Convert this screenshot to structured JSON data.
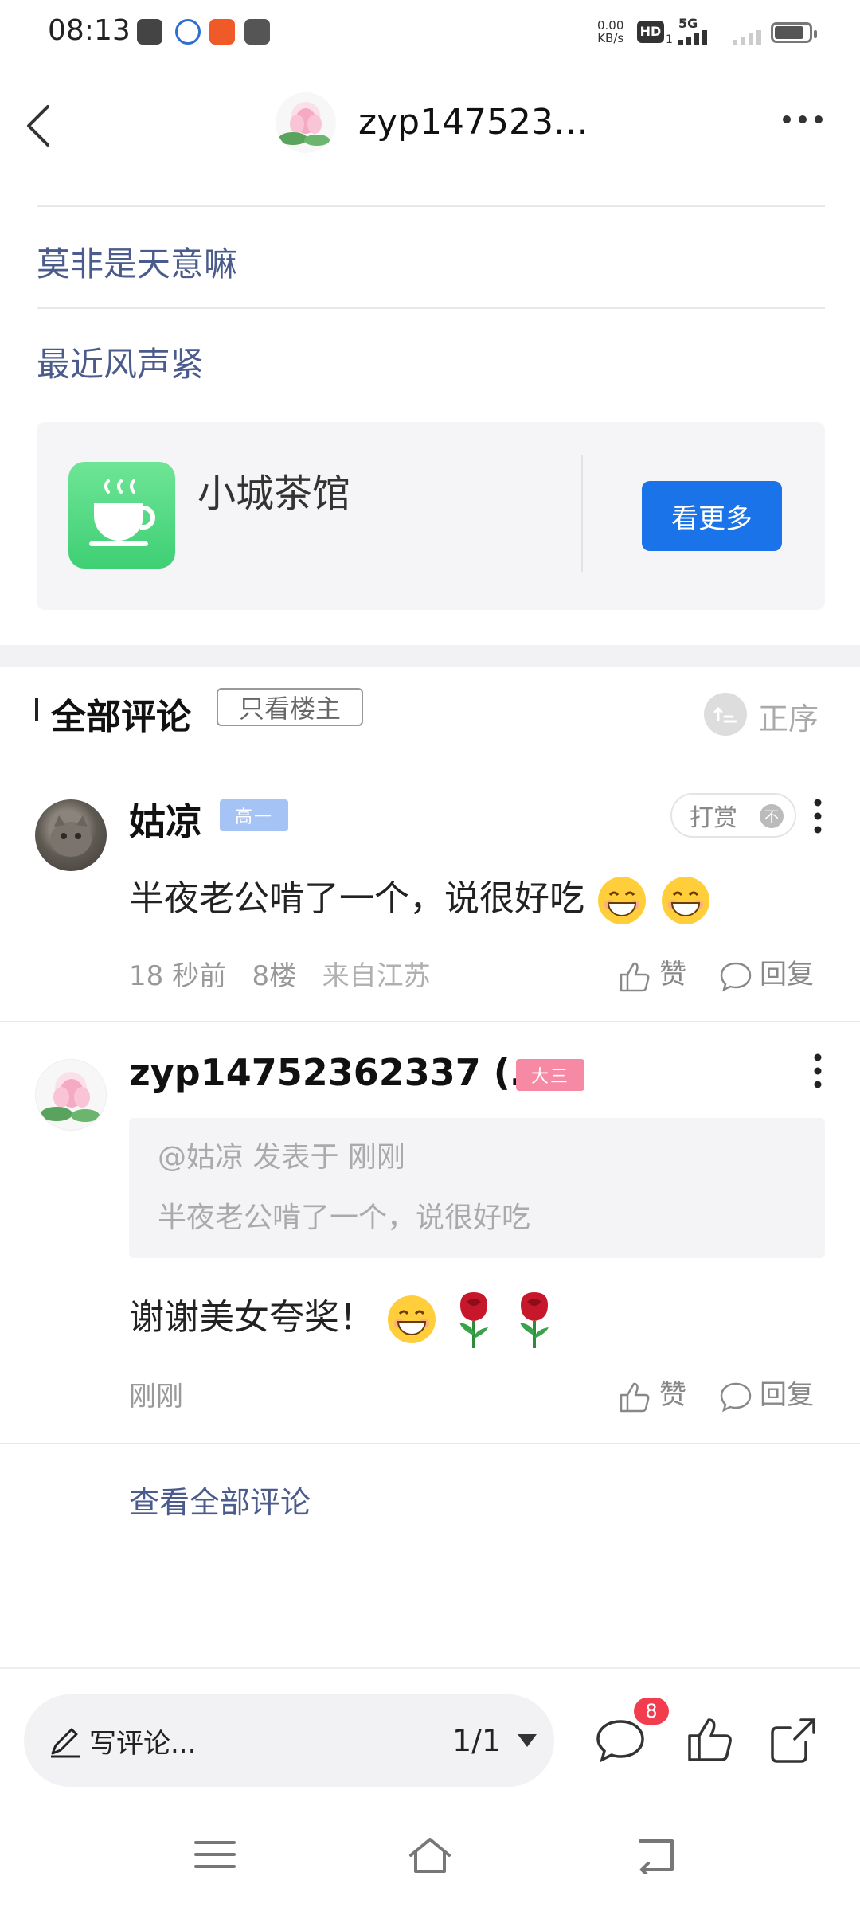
{
  "status_bar": {
    "time": "08:13",
    "net_speed_value": "0.00",
    "net_speed_unit": "KB/s",
    "hd_label": "HD",
    "hd_sub": "1",
    "network_type": "5G"
  },
  "header": {
    "title": "zyp147523…",
    "back_icon": "chevron-left-icon",
    "more_icon": "ellipsis-icon"
  },
  "links": [
    {
      "label": "莫非是天意嘛"
    },
    {
      "label": "最近风声紧"
    }
  ],
  "card": {
    "title": "小城茶馆",
    "button_label": "看更多",
    "icon": "teacup-icon",
    "accent": "#1a73e8"
  },
  "comments_header": {
    "title": "全部评论",
    "filter_label": "只看楼主",
    "sort_label": "正序"
  },
  "comments": [
    {
      "author": "姑凉",
      "level": "高一",
      "reward_label": "打赏",
      "reward_icon_text": "不",
      "text": "半夜老公啃了一个，说很好吃",
      "emojis": [
        "grin-emoji",
        "grin-emoji"
      ],
      "time": "18 秒前",
      "floor": "8楼",
      "location": "来自江苏",
      "like_label": "赞",
      "reply_label": "回复"
    },
    {
      "author": "zyp14752362337 (…",
      "level": "大三",
      "quote_header": "@姑凉 发表于 刚刚",
      "quote_text": "半夜老公啃了一个，说很好吃",
      "text": "谢谢美女夸奖！",
      "emojis": [
        "grin-emoji",
        "rose-emoji",
        "rose-emoji"
      ],
      "time": "刚刚",
      "like_label": "赞",
      "reply_label": "回复"
    }
  ],
  "view_all_label": "查看全部评论",
  "bottom_bar": {
    "write_placeholder": "写评论...",
    "page_indicator": "1/1",
    "comment_count": "8"
  },
  "colors": {
    "link": "#4a5b8c",
    "badge": "#f23d4f",
    "level_blue": "#a6c3f5",
    "level_pink": "#f68aa5"
  }
}
